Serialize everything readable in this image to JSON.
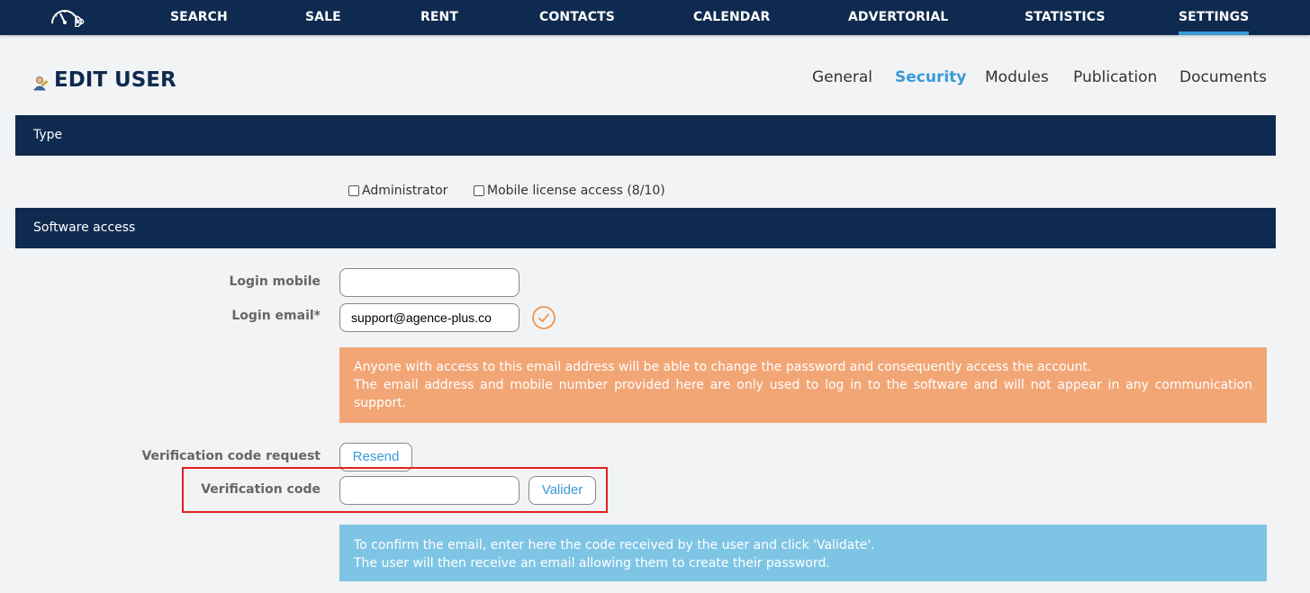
{
  "nav": {
    "items": [
      {
        "label": "SEARCH"
      },
      {
        "label": "SALE"
      },
      {
        "label": "RENT"
      },
      {
        "label": "CONTACTS"
      },
      {
        "label": "CALENDAR"
      },
      {
        "label": "ADVERTORIAL"
      },
      {
        "label": "STATISTICS"
      },
      {
        "label": "SETTINGS",
        "active": true
      }
    ],
    "logo_icon": "speedometer-icon"
  },
  "header": {
    "title": "EDIT USER",
    "icon": "user-edit-icon",
    "tabs": [
      {
        "label": "General"
      },
      {
        "label": "Security",
        "active": true
      },
      {
        "label": "Modules"
      },
      {
        "label": "Publication"
      },
      {
        "label": "Documents"
      }
    ]
  },
  "sections": {
    "type": {
      "title": "Type",
      "checkboxes": [
        {
          "label": "Administrator",
          "checked": false
        },
        {
          "label": "Mobile license access (8/10)",
          "checked": false
        }
      ]
    },
    "software_access": {
      "title": "Software access",
      "login_mobile": {
        "label": "Login mobile",
        "value": ""
      },
      "login_email": {
        "label": "Login email*",
        "value": "support@agence-plus.co",
        "verified_icon": "check-circle-icon"
      },
      "email_notice": {
        "line1": "Anyone with access to this email address will be able to change the password and consequently access the account.",
        "line2": "The email address and mobile number provided here are only used to log in to the software and will not appear in any communication support."
      },
      "verification_request": {
        "label": "Verification code request",
        "button": "Resend"
      },
      "verification_code": {
        "label": "Verification code",
        "value": "",
        "button": "Valider"
      },
      "code_notice": {
        "line1": "To confirm the email, enter here the code received by the user and click 'Validate'.",
        "line2": "The user will then receive an email allowing them to create their password."
      }
    }
  },
  "colors": {
    "navy": "#0f2a4f",
    "accent": "#3a9ad9",
    "warning": "#f2a676",
    "info": "#7ec5e5",
    "highlight": "#e02020"
  }
}
